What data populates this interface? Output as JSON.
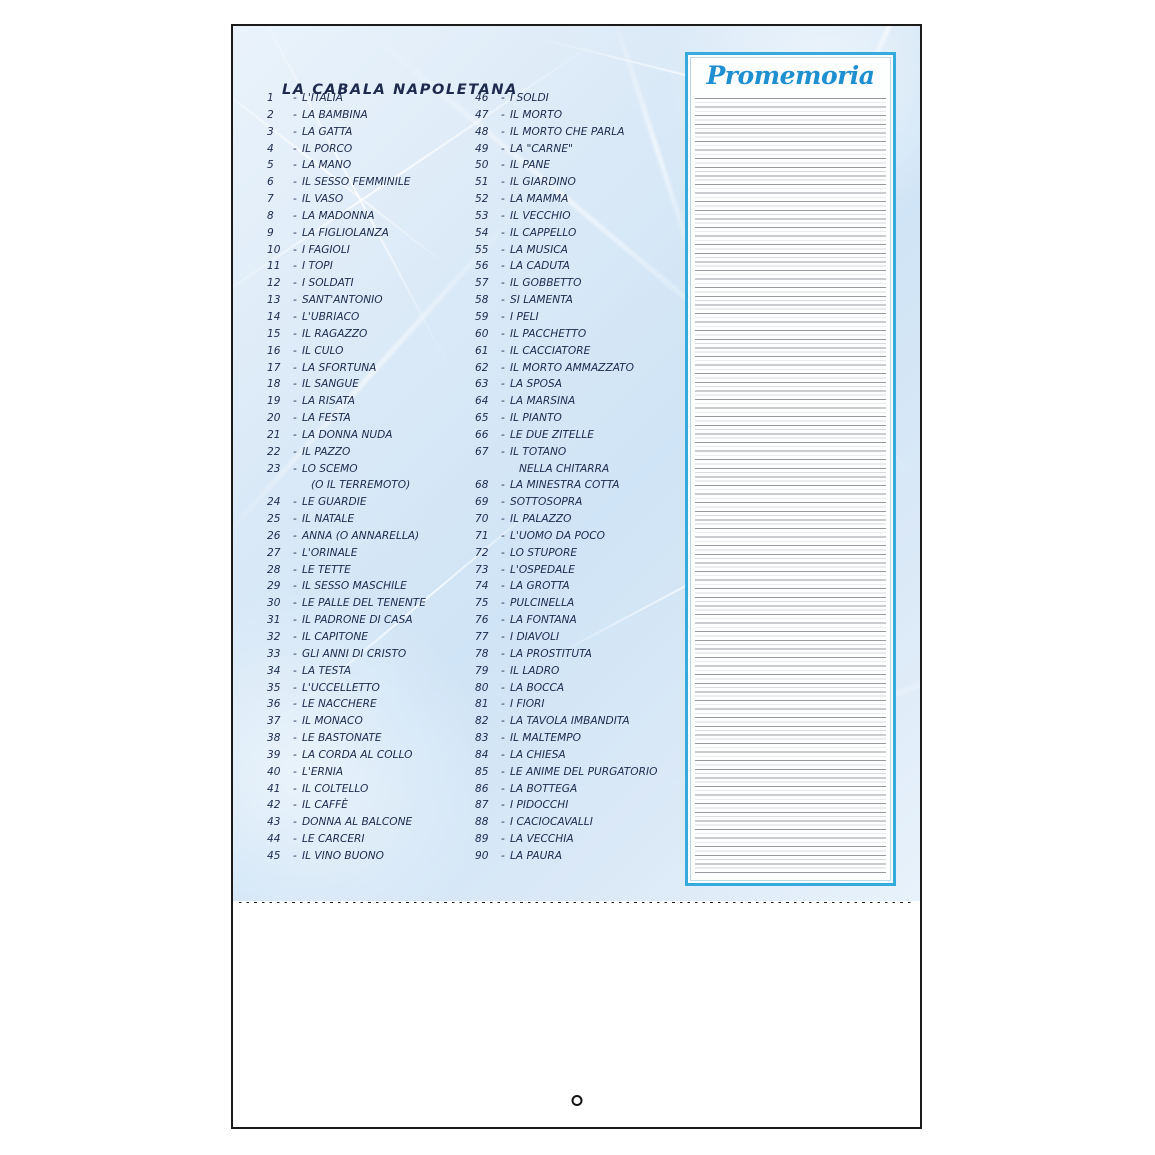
{
  "page": {
    "title": "LA CABALA NAPOLETANA"
  },
  "notepad": {
    "title": "Promemoria",
    "ruled_line_count": 88
  },
  "colors": {
    "title_text": "#1d2a4d",
    "entry_text": "#1d2a4d",
    "notepad_border": "#35abdd",
    "notepad_title": "#1e8fd0",
    "panel_background": "#dceaf7",
    "sheet_border": "#1b1b1b",
    "rule_line": "#7d8288"
  },
  "icons": {
    "punch_hole": "punch-hole-icon",
    "perforation": "perforation-dotted-line"
  },
  "list_left": [
    {
      "num": "1",
      "dash": "-",
      "label": "L'ITALIA"
    },
    {
      "num": "2",
      "dash": "-",
      "label": "LA BAMBINA"
    },
    {
      "num": "3",
      "dash": "-",
      "label": "LA GATTA"
    },
    {
      "num": "4",
      "dash": "-",
      "label": "IL PORCO"
    },
    {
      "num": "5",
      "dash": "-",
      "label": "LA MANO"
    },
    {
      "num": "6",
      "dash": "-",
      "label": "IL SESSO FEMMINILE"
    },
    {
      "num": "7",
      "dash": "-",
      "label": "IL VASO"
    },
    {
      "num": "8",
      "dash": "-",
      "label": "LA MADONNA"
    },
    {
      "num": "9",
      "dash": "-",
      "label": "LA FIGLIOLANZA"
    },
    {
      "num": "10",
      "dash": "-",
      "label": "I FAGIOLI"
    },
    {
      "num": "11",
      "dash": "-",
      "label": "I TOPI"
    },
    {
      "num": "12",
      "dash": "-",
      "label": "I SOLDATI"
    },
    {
      "num": "13",
      "dash": "-",
      "label": "SANT'ANTONIO"
    },
    {
      "num": "14",
      "dash": "-",
      "label": "L'UBRIACO"
    },
    {
      "num": "15",
      "dash": "-",
      "label": "IL RAGAZZO"
    },
    {
      "num": "16",
      "dash": "-",
      "label": "IL CULO"
    },
    {
      "num": "17",
      "dash": "-",
      "label": "LA SFORTUNA"
    },
    {
      "num": "18",
      "dash": "-",
      "label": "IL SANGUE"
    },
    {
      "num": "19",
      "dash": "-",
      "label": "LA RISATA"
    },
    {
      "num": "20",
      "dash": "-",
      "label": "LA FESTA"
    },
    {
      "num": "21",
      "dash": "-",
      "label": "LA DONNA NUDA"
    },
    {
      "num": "22",
      "dash": "-",
      "label": "IL PAZZO"
    },
    {
      "num": "23",
      "dash": "-",
      "label": "LO SCEMO"
    },
    {
      "num": "",
      "dash": "",
      "label": "(O IL TERREMOTO)",
      "continuation": true
    },
    {
      "num": "24",
      "dash": "-",
      "label": "LE GUARDIE"
    },
    {
      "num": "25",
      "dash": "-",
      "label": "IL NATALE"
    },
    {
      "num": "26",
      "dash": "-",
      "label": "ANNA (O ANNARELLA)"
    },
    {
      "num": "27",
      "dash": "-",
      "label": "L'ORINALE"
    },
    {
      "num": "28",
      "dash": "-",
      "label": "LE TETTE"
    },
    {
      "num": "29",
      "dash": "-",
      "label": "IL SESSO MASCHILE"
    },
    {
      "num": "30",
      "dash": "-",
      "label": "LE PALLE DEL TENENTE"
    },
    {
      "num": "31",
      "dash": "-",
      "label": "IL PADRONE DI CASA"
    },
    {
      "num": "32",
      "dash": "-",
      "label": "IL CAPITONE"
    },
    {
      "num": "33",
      "dash": "-",
      "label": "GLI ANNI DI CRISTO"
    },
    {
      "num": "34",
      "dash": "-",
      "label": "LA TESTA"
    },
    {
      "num": "35",
      "dash": "-",
      "label": "L'UCCELLETTO"
    },
    {
      "num": "36",
      "dash": "-",
      "label": "LE NACCHERE"
    },
    {
      "num": "37",
      "dash": "-",
      "label": "IL MONACO"
    },
    {
      "num": "38",
      "dash": "-",
      "label": "LE BASTONATE"
    },
    {
      "num": "39",
      "dash": "-",
      "label": "LA CORDA AL COLLO"
    },
    {
      "num": "40",
      "dash": "-",
      "label": "L'ERNIA"
    },
    {
      "num": "41",
      "dash": "-",
      "label": "IL COLTELLO"
    },
    {
      "num": "42",
      "dash": "-",
      "label": "IL CAFFÈ"
    },
    {
      "num": "43",
      "dash": "-",
      "label": "DONNA AL BALCONE"
    },
    {
      "num": "44",
      "dash": "-",
      "label": "LE CARCERI"
    },
    {
      "num": "45",
      "dash": "-",
      "label": "IL VINO BUONO"
    }
  ],
  "list_right": [
    {
      "num": "46",
      "dash": "-",
      "label": "I SOLDI"
    },
    {
      "num": "47",
      "dash": "-",
      "label": "IL MORTO"
    },
    {
      "num": "48",
      "dash": "-",
      "label": "IL MORTO CHE PARLA"
    },
    {
      "num": "49",
      "dash": "-",
      "label": "LA \"CARNE\""
    },
    {
      "num": "50",
      "dash": "-",
      "label": "IL PANE"
    },
    {
      "num": "51",
      "dash": "-",
      "label": "IL GIARDINO"
    },
    {
      "num": "52",
      "dash": "-",
      "label": "LA MAMMA"
    },
    {
      "num": "53",
      "dash": "-",
      "label": "IL VECCHIO"
    },
    {
      "num": "54",
      "dash": "-",
      "label": "IL CAPPELLO"
    },
    {
      "num": "55",
      "dash": "-",
      "label": "LA MUSICA"
    },
    {
      "num": "56",
      "dash": "-",
      "label": "LA CADUTA"
    },
    {
      "num": "57",
      "dash": "-",
      "label": "IL GOBBETTO"
    },
    {
      "num": "58",
      "dash": "-",
      "label": "SI LAMENTA"
    },
    {
      "num": "59",
      "dash": "-",
      "label": "I PELI"
    },
    {
      "num": "60",
      "dash": "-",
      "label": "IL PACCHETTO"
    },
    {
      "num": "61",
      "dash": "-",
      "label": "IL CACCIATORE"
    },
    {
      "num": "62",
      "dash": "-",
      "label": "IL MORTO AMMAZZATO"
    },
    {
      "num": "63",
      "dash": "-",
      "label": "LA SPOSA"
    },
    {
      "num": "64",
      "dash": "-",
      "label": "LA MARSINA"
    },
    {
      "num": "65",
      "dash": "-",
      "label": "IL PIANTO"
    },
    {
      "num": "66",
      "dash": "-",
      "label": "LE DUE ZITELLE"
    },
    {
      "num": "67",
      "dash": "-",
      "label": "IL TOTANO"
    },
    {
      "num": "",
      "dash": "",
      "label": "NELLA CHITARRA",
      "continuation": true
    },
    {
      "num": "68",
      "dash": "-",
      "label": "LA MINESTRA COTTA"
    },
    {
      "num": "69",
      "dash": "-",
      "label": "SOTTOSOPRA"
    },
    {
      "num": "70",
      "dash": "-",
      "label": "IL PALAZZO"
    },
    {
      "num": "71",
      "dash": "-",
      "label": "L'UOMO DA POCO"
    },
    {
      "num": "72",
      "dash": "-",
      "label": "LO STUPORE"
    },
    {
      "num": "73",
      "dash": "-",
      "label": "L'OSPEDALE"
    },
    {
      "num": "74",
      "dash": "-",
      "label": "LA GROTTA"
    },
    {
      "num": "75",
      "dash": "-",
      "label": "PULCINELLA"
    },
    {
      "num": "76",
      "dash": "-",
      "label": "LA FONTANA"
    },
    {
      "num": "77",
      "dash": "-",
      "label": "I DIAVOLI"
    },
    {
      "num": "78",
      "dash": "-",
      "label": "LA PROSTITUTA"
    },
    {
      "num": "79",
      "dash": "-",
      "label": "IL LADRO"
    },
    {
      "num": "80",
      "dash": "-",
      "label": "LA BOCCA"
    },
    {
      "num": "81",
      "dash": "-",
      "label": "I FIORI"
    },
    {
      "num": "82",
      "dash": "-",
      "label": "LA TAVOLA IMBANDITA"
    },
    {
      "num": "83",
      "dash": "-",
      "label": "IL MALTEMPO"
    },
    {
      "num": "84",
      "dash": "-",
      "label": "LA CHIESA"
    },
    {
      "num": "85",
      "dash": "-",
      "label": "LE ANIME DEL PURGATORIO"
    },
    {
      "num": "86",
      "dash": "-",
      "label": "LA BOTTEGA"
    },
    {
      "num": "87",
      "dash": "-",
      "label": "I PIDOCCHI"
    },
    {
      "num": "88",
      "dash": "-",
      "label": "I CACIOCAVALLI"
    },
    {
      "num": "89",
      "dash": "-",
      "label": "LA VECCHIA"
    },
    {
      "num": "90",
      "dash": "-",
      "label": "LA PAURA"
    }
  ]
}
